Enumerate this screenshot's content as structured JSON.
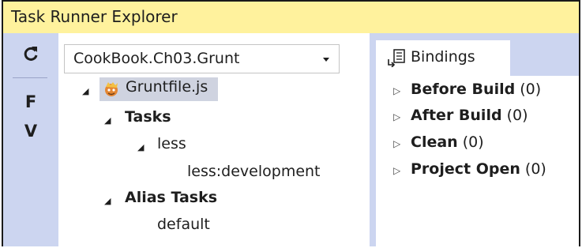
{
  "window": {
    "title": "Task Runner Explorer"
  },
  "toolbar": {
    "refresh_icon": "refresh-icon",
    "buttons": [
      {
        "label": "F"
      },
      {
        "label": "V"
      }
    ]
  },
  "project_combo": {
    "value": "CookBook.Ch03.Grunt"
  },
  "tree": {
    "root": {
      "label": "Gruntfile.js",
      "icon": "grunt-icon"
    },
    "tasks_label": "Tasks",
    "tasks": [
      {
        "label": "less",
        "children": [
          {
            "label": "less:development"
          }
        ]
      }
    ],
    "alias_label": "Alias Tasks",
    "alias_tasks": [
      {
        "label": "default"
      }
    ]
  },
  "bindings": {
    "tab_label": "Bindings",
    "items": [
      {
        "name": "Before Build",
        "count": "(0)"
      },
      {
        "name": "After Build",
        "count": "(0)"
      },
      {
        "name": "Clean",
        "count": "(0)"
      },
      {
        "name": "Project Open",
        "count": "(0)"
      }
    ]
  }
}
